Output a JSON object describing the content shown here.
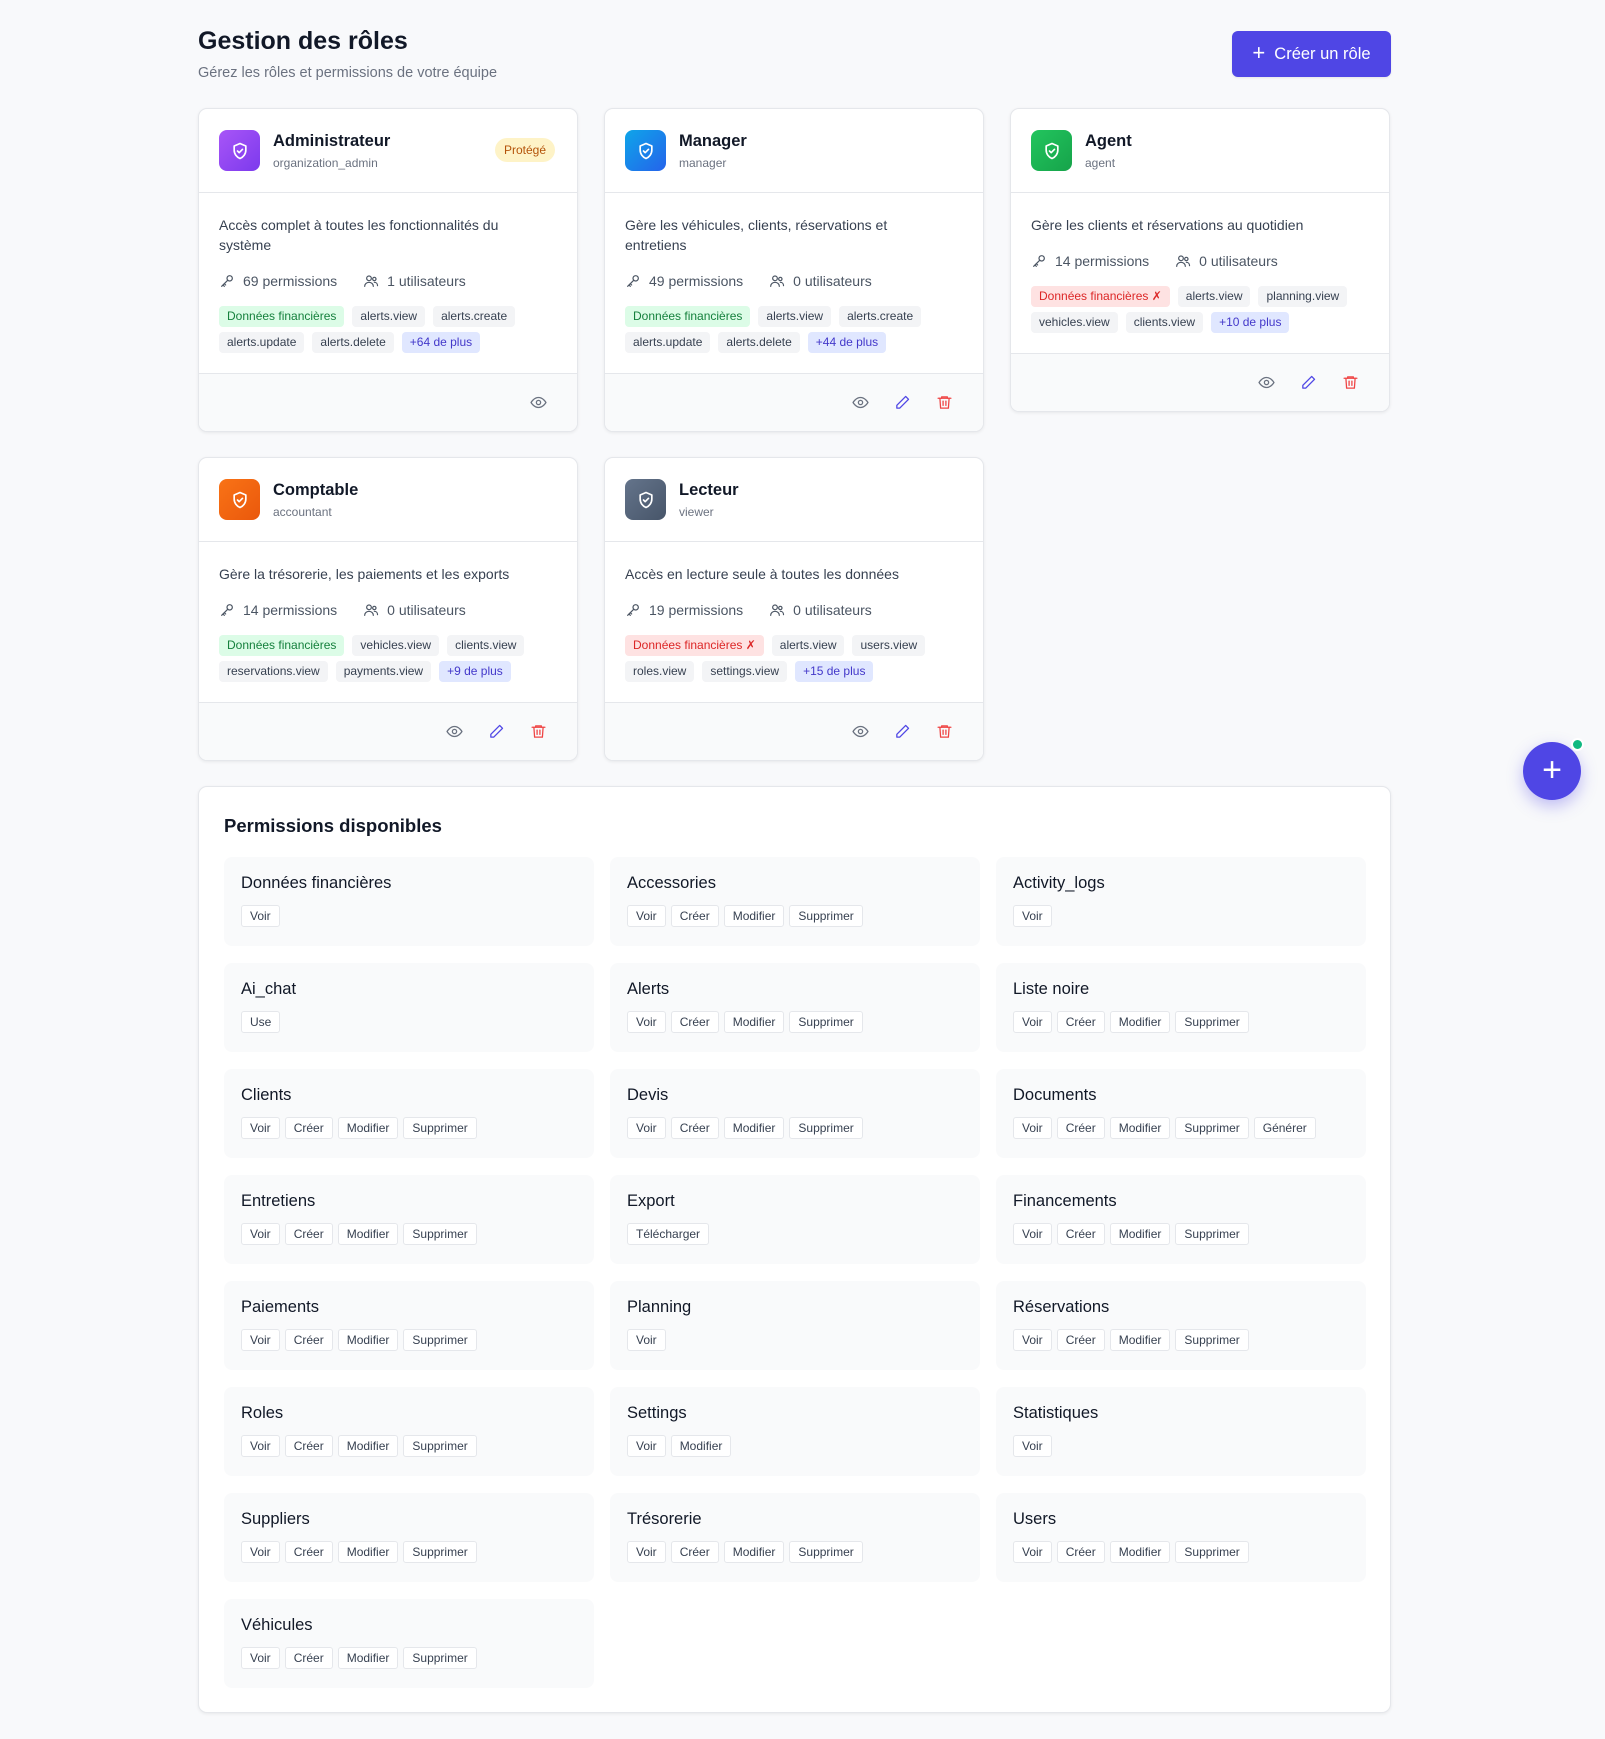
{
  "header": {
    "title": "Gestion des rôles",
    "subtitle": "Gérez les rôles et permissions de votre équipe",
    "create_label": "Créer un rôle"
  },
  "colors": {
    "primary": "#4f46e5",
    "admin_gradient": [
      "#a855f7",
      "#7c3aed"
    ],
    "manager_gradient": [
      "#0ea5e9",
      "#2563eb"
    ],
    "agent_gradient": [
      "#22c55e",
      "#16a34a"
    ],
    "accountant_gradient": [
      "#f97316",
      "#ea580c"
    ],
    "viewer_gradient": [
      "#64748b",
      "#475569"
    ],
    "financial_ok": "#15803d",
    "financial_denied": "#dc2626",
    "delete": "#ef4444"
  },
  "roles": [
    {
      "name": "Administrateur",
      "key": "organization_admin",
      "badge": "Protégé",
      "description": "Accès complet à toutes les fonctionnalités du système",
      "permissions": "69 permissions",
      "users": "1 utilisateurs",
      "tags": [
        "Données financières",
        "alerts.view",
        "alerts.create",
        "alerts.update",
        "alerts.delete",
        "+64 de plus"
      ],
      "actions": [
        "eye-icon"
      ]
    },
    {
      "name": "Manager",
      "key": "manager",
      "description": "Gère les véhicules, clients, réservations et entretiens",
      "permissions": "49 permissions",
      "users": "0 utilisateurs",
      "tags": [
        "Données financières",
        "alerts.view",
        "alerts.create",
        "alerts.update",
        "alerts.delete",
        "+44 de plus"
      ],
      "actions": [
        "eye-icon",
        "pencil-icon",
        "trash-icon"
      ]
    },
    {
      "name": "Agent",
      "key": "agent",
      "description": "Gère les clients et réservations au quotidien",
      "permissions": "14 permissions",
      "users": "0 utilisateurs",
      "tags": [
        "Données financières ✗",
        "alerts.view",
        "planning.view",
        "vehicles.view",
        "clients.view",
        "+10 de plus"
      ],
      "actions": [
        "eye-icon",
        "pencil-icon",
        "trash-icon"
      ]
    },
    {
      "name": "Comptable",
      "key": "accountant",
      "description": "Gère la trésorerie, les paiements et les exports",
      "permissions": "14 permissions",
      "users": "0 utilisateurs",
      "tags": [
        "Données financières",
        "vehicles.view",
        "clients.view",
        "reservations.view",
        "payments.view",
        "+9 de plus"
      ],
      "actions": [
        "eye-icon",
        "pencil-icon",
        "trash-icon"
      ]
    },
    {
      "name": "Lecteur",
      "key": "viewer",
      "description": "Accès en lecture seule à toutes les données",
      "permissions": "19 permissions",
      "users": "0 utilisateurs",
      "tags": [
        "Données financières ✗",
        "alerts.view",
        "users.view",
        "roles.view",
        "settings.view",
        "+15 de plus"
      ],
      "actions": [
        "eye-icon",
        "pencil-icon",
        "trash-icon"
      ]
    }
  ],
  "permissions_panel": {
    "title": "Permissions disponibles",
    "groups": [
      {
        "name": "Données financières",
        "actions": [
          "Voir"
        ]
      },
      {
        "name": "Accessories",
        "actions": [
          "Voir",
          "Créer",
          "Modifier",
          "Supprimer"
        ]
      },
      {
        "name": "Activity_logs",
        "actions": [
          "Voir"
        ]
      },
      {
        "name": "Ai_chat",
        "actions": [
          "Use"
        ]
      },
      {
        "name": "Alerts",
        "actions": [
          "Voir",
          "Créer",
          "Modifier",
          "Supprimer"
        ]
      },
      {
        "name": "Liste noire",
        "actions": [
          "Voir",
          "Créer",
          "Modifier",
          "Supprimer"
        ]
      },
      {
        "name": "Clients",
        "actions": [
          "Voir",
          "Créer",
          "Modifier",
          "Supprimer"
        ]
      },
      {
        "name": "Devis",
        "actions": [
          "Voir",
          "Créer",
          "Modifier",
          "Supprimer"
        ]
      },
      {
        "name": "Documents",
        "actions": [
          "Voir",
          "Créer",
          "Modifier",
          "Supprimer",
          "Générer"
        ]
      },
      {
        "name": "Entretiens",
        "actions": [
          "Voir",
          "Créer",
          "Modifier",
          "Supprimer"
        ]
      },
      {
        "name": "Export",
        "actions": [
          "Télécharger"
        ]
      },
      {
        "name": "Financements",
        "actions": [
          "Voir",
          "Créer",
          "Modifier",
          "Supprimer"
        ]
      },
      {
        "name": "Paiements",
        "actions": [
          "Voir",
          "Créer",
          "Modifier",
          "Supprimer"
        ]
      },
      {
        "name": "Planning",
        "actions": [
          "Voir"
        ]
      },
      {
        "name": "Réservations",
        "actions": [
          "Voir",
          "Créer",
          "Modifier",
          "Supprimer"
        ]
      },
      {
        "name": "Roles",
        "actions": [
          "Voir",
          "Créer",
          "Modifier",
          "Supprimer"
        ]
      },
      {
        "name": "Settings",
        "actions": [
          "Voir",
          "Modifier"
        ]
      },
      {
        "name": "Statistiques",
        "actions": [
          "Voir"
        ]
      },
      {
        "name": "Suppliers",
        "actions": [
          "Voir",
          "Créer",
          "Modifier",
          "Supprimer"
        ]
      },
      {
        "name": "Trésorerie",
        "actions": [
          "Voir",
          "Créer",
          "Modifier",
          "Supprimer"
        ]
      },
      {
        "name": "Users",
        "actions": [
          "Voir",
          "Créer",
          "Modifier",
          "Supprimer"
        ]
      },
      {
        "name": "Véhicules",
        "actions": [
          "Voir",
          "Créer",
          "Modifier",
          "Supprimer"
        ]
      }
    ]
  },
  "fab": {
    "icon": "plus-icon",
    "status_dot": "online-dot"
  }
}
